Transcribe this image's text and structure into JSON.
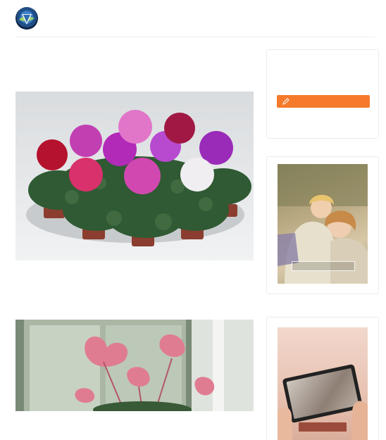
{
  "author": {
    "site": "",
    "name": "",
    "date": ""
  },
  "article": {
    "intro": "",
    "heading_description": "",
    "description_text": "",
    "heading_conditions": ""
  },
  "sidebar": {
    "author_card": {
      "label": "",
      "title": "",
      "text": "",
      "button_label": "",
      "button_color": "#f57a2b"
    },
    "ad1": {
      "headline": "",
      "button_label": ""
    },
    "ad2": {
      "headline": "",
      "button_label": "",
      "button_color": "#9b4b3b"
    }
  }
}
